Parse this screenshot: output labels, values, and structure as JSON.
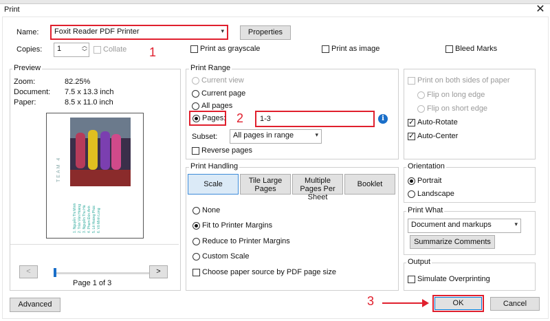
{
  "window": {
    "title": "Print",
    "close": "✕"
  },
  "printer": {
    "name_label": "Name:",
    "name_value": "Foxit Reader PDF Printer",
    "properties_label": "Properties",
    "copies_label": "Copies:",
    "copies_value": "1",
    "collate_label": "Collate",
    "grayscale_label": "Print as grayscale",
    "print_image_label": "Print as image",
    "bleed_label": "Bleed Marks"
  },
  "preview": {
    "legend": "Preview",
    "zoom_label": "Zoom:",
    "zoom_value": "82.25%",
    "document_label": "Document:",
    "document_value": "7.5 x 13.3 inch",
    "paper_label": "Paper:",
    "paper_value": "8.5 x 11.0 inch",
    "page_team": "TEAM 4",
    "page_names": [
      "1. Nguyễn Thị Minh",
      "2. Trần Văn Hoàng",
      "3. Nguyễn Thu Hà",
      "4. Phạm Đức Anh",
      "5. Lê Hoàng Phúc",
      "6. Võ Minh Long"
    ],
    "prev": "<",
    "next": ">",
    "page_indicator": "Page 1 of 3",
    "slider_fraction": 0.0
  },
  "print_range": {
    "legend": "Print Range",
    "current_view": "Current view",
    "current_page": "Current page",
    "all_pages": "All pages",
    "pages_label": "Pages:",
    "pages_value": "1-3",
    "subset_label": "Subset:",
    "subset_value": "All pages in range",
    "reverse_label": "Reverse pages"
  },
  "handling": {
    "legend": "Print Handling",
    "tab_scale": "Scale",
    "tab_tile": "Tile Large Pages",
    "tab_multi": "Multiple Pages Per Sheet",
    "tab_booklet": "Booklet",
    "opt_none": "None",
    "opt_fit": "Fit to Printer Margins",
    "opt_reduce": "Reduce to Printer Margins",
    "opt_custom": "Custom Scale",
    "paper_source": "Choose paper source by PDF page size"
  },
  "duplex": {
    "both_sides": "Print on both sides of paper",
    "flip_long": "Flip on long edge",
    "flip_short": "Flip on short edge",
    "auto_rotate": "Auto-Rotate",
    "auto_center": "Auto-Center"
  },
  "orientation": {
    "legend": "Orientation",
    "portrait": "Portrait",
    "landscape": "Landscape"
  },
  "print_what": {
    "legend": "Print What",
    "value": "Document and markups",
    "summarize": "Summarize Comments"
  },
  "output": {
    "legend": "Output",
    "simulate": "Simulate Overprinting"
  },
  "footer": {
    "advanced": "Advanced",
    "ok": "OK",
    "cancel": "Cancel"
  },
  "annotations": {
    "step1": "1",
    "step2": "2",
    "step3": "3"
  },
  "colors": {
    "highlight": "#e01f2d",
    "info_blue": "#1a6fc9",
    "selected_tab": "#dbeaf7"
  }
}
